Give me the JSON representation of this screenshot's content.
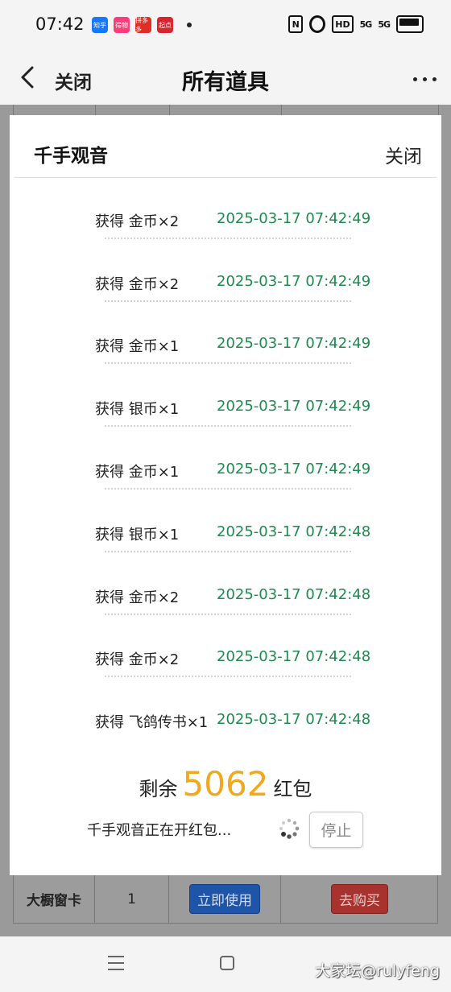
{
  "status_bar": {
    "time": "07:42",
    "apps": [
      {
        "name": "知乎",
        "color": "#1677ff"
      },
      {
        "name": "得物",
        "color": "#ff3c7a"
      },
      {
        "name": "拼多多",
        "color": "#e02e24"
      },
      {
        "name": "起点",
        "color": "#d9232d"
      }
    ],
    "nfc": "N",
    "hd": "HD",
    "sig1": "5G",
    "sig2": "5G"
  },
  "title_bar": {
    "close_label": "关闭",
    "title": "所有道具"
  },
  "modal": {
    "title": "千手观音",
    "close_label": "关闭",
    "log": [
      {
        "desc": "获得 金币×2",
        "time": "2025-03-17 07:42:49"
      },
      {
        "desc": "获得 金币×2",
        "time": "2025-03-17 07:42:49"
      },
      {
        "desc": "获得 金币×1",
        "time": "2025-03-17 07:42:49"
      },
      {
        "desc": "获得 银币×1",
        "time": "2025-03-17 07:42:49"
      },
      {
        "desc": "获得 金币×1",
        "time": "2025-03-17 07:42:49"
      },
      {
        "desc": "获得 银币×1",
        "time": "2025-03-17 07:42:48"
      },
      {
        "desc": "获得 金币×2",
        "time": "2025-03-17 07:42:48"
      },
      {
        "desc": "获得 金币×2",
        "time": "2025-03-17 07:42:48"
      },
      {
        "desc": "获得 飞鸽传书×1",
        "time": "2025-03-17 07:42:48"
      }
    ],
    "remain_prefix": "剩余",
    "remain_count": "5062",
    "remain_suffix": "红包",
    "status_text": "千手观音正在开红包...",
    "stop_label": "停止"
  },
  "background_table": {
    "item_name": "大橱窗卡",
    "quantity": "1",
    "use_label": "立即使用",
    "buy_label": "去购买"
  },
  "nav": {
    "watermark": "大家坛@rulyfeng"
  }
}
